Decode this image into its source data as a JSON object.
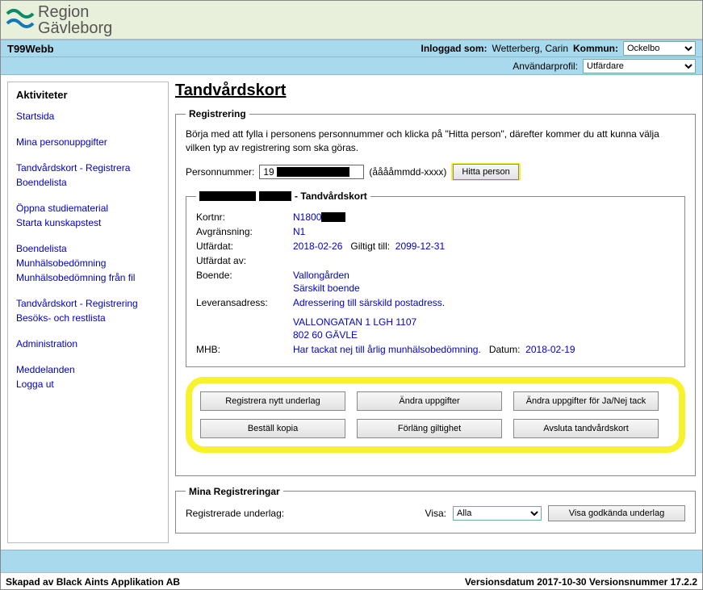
{
  "header": {
    "logo_line1": "Region",
    "logo_line2": "Gävleborg",
    "app_name": "T99Webb",
    "logged_in_label": "Inloggad som:",
    "logged_in_user": "Wetterberg, Carin",
    "kommun_label": "Kommun:",
    "kommun_value": "Ockelbo",
    "profile_label": "Användarprofil:",
    "profile_value": "Utfärdare"
  },
  "sidebar": {
    "title": "Aktiviteter",
    "items_g1": [
      "Startsida"
    ],
    "items_g2": [
      "Mina personuppgifter"
    ],
    "items_g3": [
      "Tandvårdskort - Registrera",
      "Boendelista"
    ],
    "items_g4": [
      "Öppna studiematerial",
      "Starta kunskapstest"
    ],
    "items_g5": [
      "Boendelista",
      "Munhälsobedömning",
      "Munhälsobedömning från fil"
    ],
    "items_g6": [
      "Tandvårdskort - Registrering",
      "Besöks- och restlista"
    ],
    "items_g7": [
      "Administration"
    ],
    "items_g8": [
      "Meddelanden",
      "Logga ut"
    ]
  },
  "main": {
    "title": "Tandvårdskort",
    "reg": {
      "legend": "Registrering",
      "instr": "Börja med att fylla i personens personnummer och klicka på \"Hitta person\", därefter kommer du att kunna välja vilken typ av registrering som ska göras.",
      "personnr_label": "Personnummer:",
      "personnr_value": "19",
      "personnr_hint": "(ååååmmdd-xxxx)",
      "find_button": "Hitta person"
    },
    "card": {
      "legend_suffix": " - Tandvårdskort",
      "kortnr_label": "Kortnr:",
      "kortnr_value": "N1800",
      "avgr_label": "Avgränsning:",
      "avgr_value": "N1",
      "utf_label": "Utfärdat:",
      "utf_date": "2018-02-26",
      "giltigt_label": "Giltigt till:",
      "giltigt_date": "2099-12-31",
      "utf_av_label": "Utfärdat av:",
      "boende_label": "Boende:",
      "boende_line1": "Vallongården",
      "boende_line2": "Särskilt boende",
      "lev_label": "Leveransadress:",
      "lev_line1": "Adressering till särskild postadress.",
      "lev_line2": "VALLONGATAN 1 LGH 1107",
      "lev_line3": "802 60   GÄVLE",
      "mhb_label": "MHB:",
      "mhb_text": "Har tackat nej till årlig munhälsobedömning.",
      "mhb_date_label": "Datum:",
      "mhb_date": "2018-02-19"
    },
    "buttons": {
      "b1": "Registrera nytt underlag",
      "b2": "Ändra uppgifter",
      "b3": "Ändra uppgifter för Ja/Nej tack",
      "b4": "Beställ kopia",
      "b5": "Förläng giltighet",
      "b6": "Avsluta tandvårdskort"
    },
    "mina": {
      "legend": "Mina Registreringar",
      "reg_label": "Registrerade underlag:",
      "visa_label": "Visa:",
      "visa_value": "Alla",
      "btn": "Visa godkända underlag"
    }
  },
  "footer": {
    "left": "Skapad av Black Aints Applikation AB",
    "right": "Versionsdatum 2017-10-30 Versionsnummer 17.2.2"
  }
}
